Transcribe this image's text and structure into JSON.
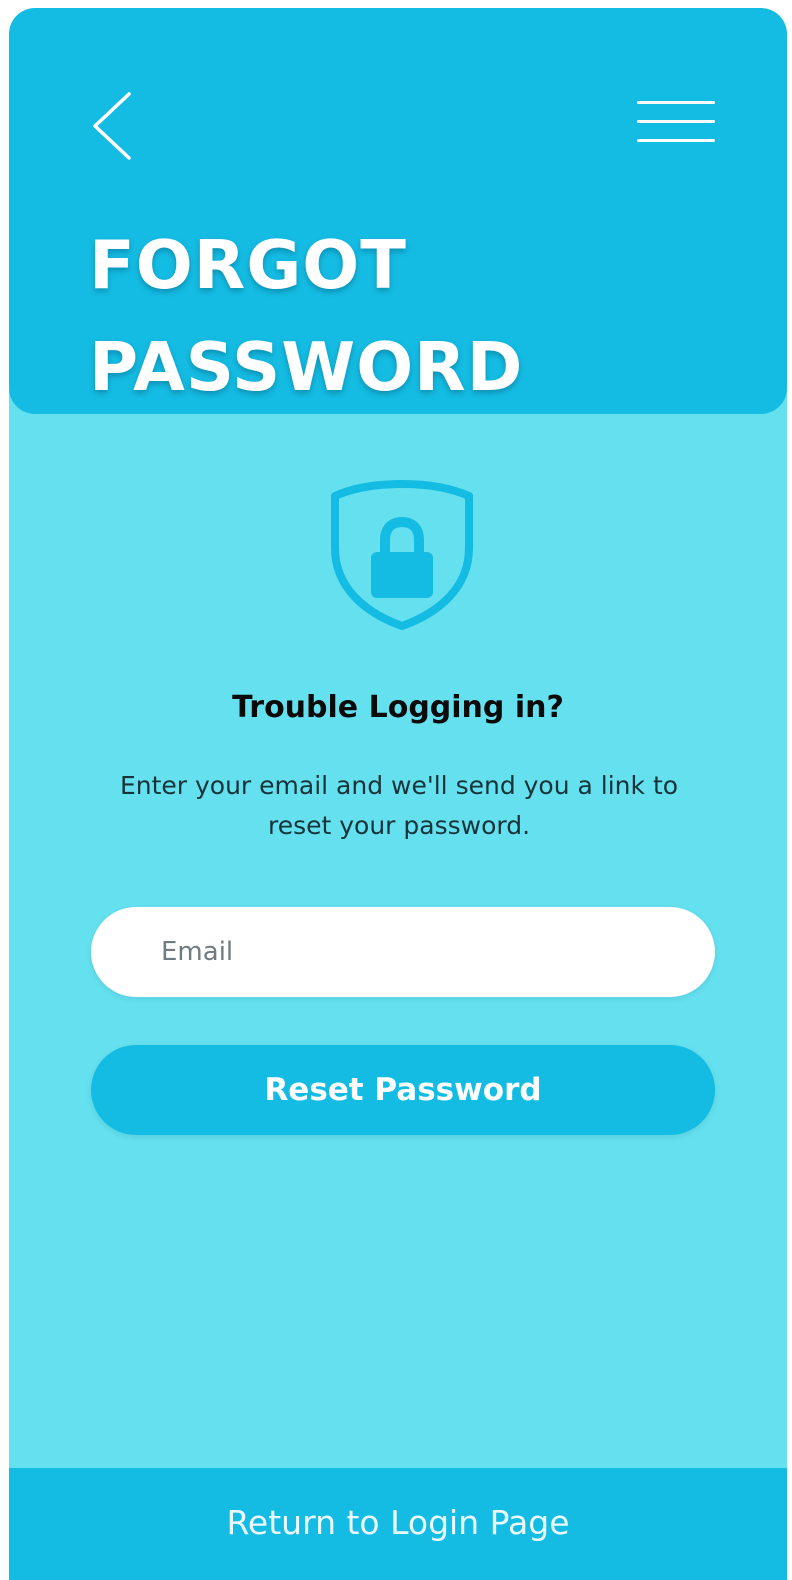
{
  "header": {
    "back_icon": "chevron-left-icon",
    "menu_icon": "hamburger-menu-icon",
    "title_line1": "FORGOT",
    "title_line2": "PASSWORD"
  },
  "main": {
    "illustration_icon": "shield-lock-icon",
    "heading": "Trouble Logging in?",
    "description": "Enter your email and we'll send you a link to reset your password.",
    "email_placeholder": "Email",
    "email_value": "",
    "reset_button_label": "Reset Password"
  },
  "footer": {
    "return_link_label": "Return to Login Page"
  },
  "colors": {
    "header_blue": "#14bce3",
    "background_cyan": "#64e0ee",
    "field_white": "#ffffff",
    "heading_text": "#0a0a0a"
  }
}
